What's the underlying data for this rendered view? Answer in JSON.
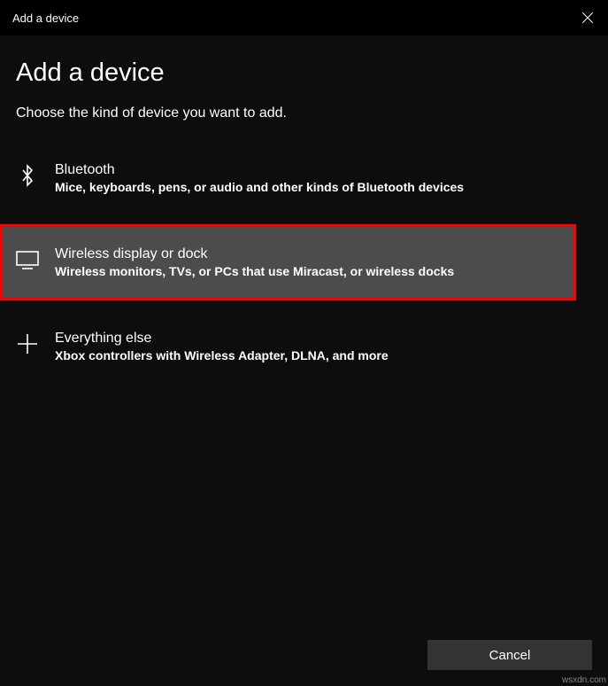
{
  "titlebar": {
    "title": "Add a device"
  },
  "main": {
    "heading": "Add a device",
    "subheading": "Choose the kind of device you want to add."
  },
  "options": [
    {
      "title": "Bluetooth",
      "description": "Mice, keyboards, pens, or audio and other kinds of Bluetooth devices"
    },
    {
      "title": "Wireless display or dock",
      "description": "Wireless monitors, TVs, or PCs that use Miracast, or wireless docks"
    },
    {
      "title": "Everything else",
      "description": "Xbox controllers with Wireless Adapter, DLNA, and more"
    }
  ],
  "footer": {
    "cancel_label": "Cancel"
  },
  "watermark": "wsxdn.com"
}
